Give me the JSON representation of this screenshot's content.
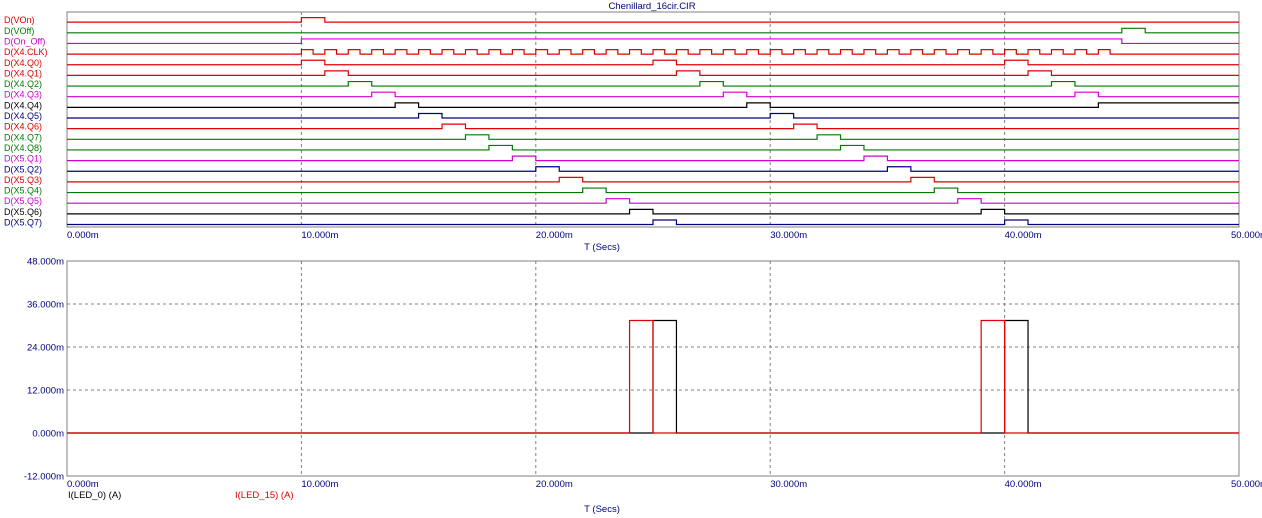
{
  "title": "Chenillard_16cir.CIR",
  "colors": {
    "red": "#e00000",
    "green": "#007a00",
    "magenta": "#d000d0",
    "black": "#000000",
    "navy": "#000080",
    "grid": "#808080"
  },
  "chart_data": [
    {
      "type": "line",
      "subtype": "digital",
      "title": "Chenillard_16cir.CIR",
      "xlabel": "T (Secs)",
      "xlim": [
        0,
        0.05
      ],
      "x_tick_values": [
        0,
        0.01,
        0.02,
        0.03,
        0.04,
        0.05
      ],
      "x_tick_labels": [
        "0.000m",
        "10.000m",
        "20.000m",
        "30.000m",
        "40.000m",
        "50.000m"
      ],
      "grid": true,
      "series": [
        {
          "name": "D(VOn)",
          "color": "red",
          "start": 0,
          "edges": [
            0.01,
            0.011
          ]
        },
        {
          "name": "D(VOff)",
          "color": "green",
          "start": 0,
          "edges": [
            0.045,
            0.046
          ]
        },
        {
          "name": "D(On_Off)",
          "color": "magenta",
          "start": 0,
          "edges": [
            0.01,
            0.045
          ]
        },
        {
          "name": "D(X4.CLK)",
          "color": "red",
          "start": 0,
          "clock": {
            "from": 0.01,
            "to": 0.045,
            "period": 0.001
          }
        },
        {
          "name": "D(X4.Q0)",
          "color": "red",
          "start": 0,
          "edges": [
            0.01,
            0.011,
            0.025,
            0.026,
            0.04,
            0.041
          ]
        },
        {
          "name": "D(X4.Q1)",
          "color": "red",
          "start": 0,
          "edges": [
            0.011,
            0.012,
            0.026,
            0.027,
            0.041,
            0.042
          ]
        },
        {
          "name": "D(X4.Q2)",
          "color": "green",
          "start": 0,
          "edges": [
            0.012,
            0.013,
            0.027,
            0.028,
            0.042,
            0.043
          ]
        },
        {
          "name": "D(X4.Q3)",
          "color": "magenta",
          "start": 0,
          "edges": [
            0.013,
            0.014,
            0.028,
            0.029,
            0.043,
            0.044
          ]
        },
        {
          "name": "D(X4.Q4)",
          "color": "black",
          "start": 0,
          "edges": [
            0.014,
            0.015,
            0.029,
            0.03,
            0.044
          ]
        },
        {
          "name": "D(X4.Q5)",
          "color": "navy",
          "start": 0,
          "edges": [
            0.015,
            0.016,
            0.03,
            0.031
          ]
        },
        {
          "name": "D(X4.Q6)",
          "color": "red",
          "start": 0,
          "edges": [
            0.016,
            0.017,
            0.031,
            0.032
          ]
        },
        {
          "name": "D(X4.Q7)",
          "color": "green",
          "start": 0,
          "edges": [
            0.017,
            0.018,
            0.032,
            0.033
          ]
        },
        {
          "name": "D(X4.Q8)",
          "color": "green",
          "start": 0,
          "edges": [
            0.018,
            0.019,
            0.033,
            0.034
          ]
        },
        {
          "name": "D(X5.Q1)",
          "color": "magenta",
          "start": 0,
          "edges": [
            0.019,
            0.02,
            0.034,
            0.035
          ]
        },
        {
          "name": "D(X5.Q2)",
          "color": "navy",
          "start": 0,
          "edges": [
            0.02,
            0.021,
            0.035,
            0.036
          ]
        },
        {
          "name": "D(X5.Q3)",
          "color": "red",
          "start": 0,
          "edges": [
            0.021,
            0.022,
            0.036,
            0.037
          ]
        },
        {
          "name": "D(X5.Q4)",
          "color": "green",
          "start": 0,
          "edges": [
            0.022,
            0.023,
            0.037,
            0.038
          ]
        },
        {
          "name": "D(X5.Q5)",
          "color": "magenta",
          "start": 0,
          "edges": [
            0.023,
            0.024,
            0.038,
            0.039
          ]
        },
        {
          "name": "D(X5.Q6)",
          "color": "black",
          "start": 0,
          "edges": [
            0.024,
            0.025,
            0.039,
            0.04
          ]
        },
        {
          "name": "D(X5.Q7)",
          "color": "navy",
          "start": 0,
          "edges": [
            0.025,
            0.026,
            0.04,
            0.041
          ]
        }
      ]
    },
    {
      "type": "line",
      "xlabel": "T (Secs)",
      "xlim": [
        0,
        0.05
      ],
      "ylim": [
        -0.012,
        0.048
      ],
      "x_tick_values": [
        0,
        0.01,
        0.02,
        0.03,
        0.04,
        0.05
      ],
      "x_tick_labels": [
        "0.000m",
        "10.000m",
        "20.000m",
        "30.000m",
        "40.000m",
        "50.000m"
      ],
      "y_tick_values": [
        -0.012,
        0,
        0.012,
        0.024,
        0.036,
        0.048
      ],
      "y_tick_labels": [
        "-12.000m",
        "0.000m",
        "12.000m",
        "24.000m",
        "36.000m",
        "48.000m"
      ],
      "grid": true,
      "series": [
        {
          "name": "I(LED_0) (A)",
          "color": "black",
          "points": [
            [
              0,
              0
            ],
            [
              0.025,
              0
            ],
            [
              0.025,
              0.0314
            ],
            [
              0.026,
              0.0314
            ],
            [
              0.026,
              0
            ],
            [
              0.04,
              0
            ],
            [
              0.04,
              0.0314
            ],
            [
              0.041,
              0.0314
            ],
            [
              0.041,
              0
            ],
            [
              0.05,
              0
            ]
          ]
        },
        {
          "name": "I(LED_15) (A)",
          "color": "red",
          "points": [
            [
              0,
              0
            ],
            [
              0.024,
              0
            ],
            [
              0.024,
              0.0314
            ],
            [
              0.025,
              0.0314
            ],
            [
              0.025,
              0
            ],
            [
              0.039,
              0
            ],
            [
              0.039,
              0.0314
            ],
            [
              0.04,
              0.0314
            ],
            [
              0.04,
              0
            ],
            [
              0.05,
              0
            ]
          ]
        }
      ]
    }
  ]
}
